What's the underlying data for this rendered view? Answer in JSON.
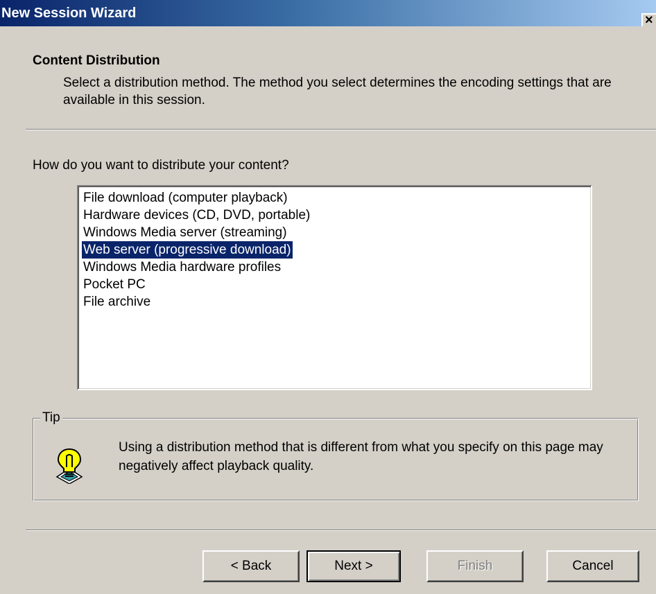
{
  "window": {
    "title": "New Session Wizard",
    "close_glyph": "×"
  },
  "header": {
    "title": "Content Distribution",
    "description": "Select a distribution method. The method you select determines the encoding settings that are available in this session."
  },
  "main": {
    "question": "How do you want to distribute your content?",
    "options": [
      "File download (computer playback)",
      "Hardware devices (CD, DVD, portable)",
      "Windows Media server (streaming)",
      "Web server (progressive download)",
      "Windows Media hardware profiles",
      "Pocket PC",
      "File archive"
    ],
    "selected_option": "Web server (progressive download)"
  },
  "tip": {
    "label": "Tip",
    "icon": "lightbulb-icon",
    "text": "Using a distribution method that is different from what you specify on this page may negatively affect playback quality."
  },
  "buttons": {
    "back": "< Back",
    "next": "Next >",
    "finish": "Finish",
    "cancel": "Cancel"
  },
  "colors": {
    "title_bar_start": "#0a246a",
    "title_bar_end": "#a6caf0",
    "selection": "#0a246a",
    "dialog_face": "#d4d0c8"
  }
}
